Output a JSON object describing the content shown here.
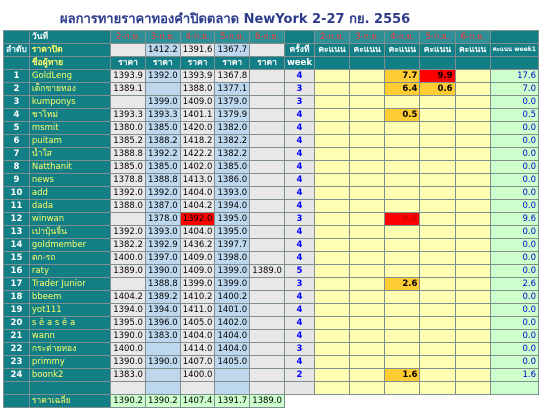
{
  "title": "ผลการทายราคาทองคำปิดตลาด NewYork 2-27 กย. 2556",
  "labels": {
    "day": "วันที่",
    "close_price": "ราคาปิด",
    "guesser": "ชื่อผู้ทาย",
    "price": "ราคา",
    "rank": "ลำดับ",
    "times": "ครั้งที่",
    "week": "week",
    "score": "คะแนน",
    "score_week": "คะแนน week1",
    "average": "ราคาเฉลี่ย"
  },
  "dates": [
    "2-ก.ย.",
    "3-ก.ย.",
    "4-ก.ย.",
    "5-ก.ย.",
    "6-ก.ย."
  ],
  "close_prices": [
    "",
    "1412.2",
    "1391.6",
    "1367.7",
    ""
  ],
  "rows": [
    {
      "n": "1",
      "name": "GoldLeng",
      "p": [
        "1393.9",
        "1392.0",
        "1393.9",
        "1367.8",
        ""
      ],
      "t": "4",
      "s": [
        "",
        "",
        "7.7",
        "9.9",
        ""
      ],
      "w": "17.6"
    },
    {
      "n": "2",
      "name": "เด็กขายทอง",
      "p": [
        "1389.1",
        "",
        "1388.0",
        "1377.1",
        ""
      ],
      "t": "3",
      "s": [
        "",
        "",
        "6.4",
        "0.6",
        ""
      ],
      "w": "7.0"
    },
    {
      "n": "3",
      "name": "kumponys",
      "p": [
        "",
        "1399.0",
        "1409.0",
        "1379.0",
        ""
      ],
      "t": "3",
      "s": [
        "",
        "",
        "",
        "",
        ""
      ],
      "w": "0.0"
    },
    {
      "n": "4",
      "name": "ชาไหม่",
      "p": [
        "1393.3",
        "1393.3",
        "1401.1",
        "1379.9",
        ""
      ],
      "t": "4",
      "s": [
        "",
        "",
        "0.5",
        "",
        ""
      ],
      "w": "0.5"
    },
    {
      "n": "5",
      "name": "msmit",
      "p": [
        "1380.0",
        "1385.0",
        "1420.0",
        "1382.0",
        ""
      ],
      "t": "4",
      "s": [
        "",
        "",
        "",
        "",
        ""
      ],
      "w": "0.0"
    },
    {
      "n": "6",
      "name": "puitam",
      "p": [
        "1385.2",
        "1388.2",
        "1418.2",
        "1382.2",
        ""
      ],
      "t": "4",
      "s": [
        "",
        "",
        "",
        "",
        ""
      ],
      "w": "0.0"
    },
    {
      "n": "7",
      "name": "น้ำใส",
      "p": [
        "1388.8",
        "1392.2",
        "1422.2",
        "1382.2",
        ""
      ],
      "t": "4",
      "s": [
        "",
        "",
        "",
        "",
        ""
      ],
      "w": "0.0"
    },
    {
      "n": "8",
      "name": "Natthanit",
      "p": [
        "1385.0",
        "1385.0",
        "1402.0",
        "1385.0",
        ""
      ],
      "t": "4",
      "s": [
        "",
        "",
        "",
        "",
        ""
      ],
      "w": "0.0"
    },
    {
      "n": "9",
      "name": "news",
      "p": [
        "1378.8",
        "1388.8",
        "1413.0",
        "1386.0",
        ""
      ],
      "t": "4",
      "s": [
        "",
        "",
        "",
        "",
        ""
      ],
      "w": "0.0"
    },
    {
      "n": "10",
      "name": "add",
      "p": [
        "1392.0",
        "1392.0",
        "1404.0",
        "1393.0",
        ""
      ],
      "t": "4",
      "s": [
        "",
        "",
        "",
        "",
        ""
      ],
      "w": "0.0"
    },
    {
      "n": "11",
      "name": "dada",
      "p": [
        "1388.0",
        "1387.0",
        "1404.2",
        "1394.0",
        ""
      ],
      "t": "4",
      "s": [
        "",
        "",
        "",
        "",
        ""
      ],
      "w": "0.0"
    },
    {
      "n": "12",
      "name": "winwan",
      "p": [
        "",
        "1378.0",
        "1392.0",
        "1395.0",
        ""
      ],
      "t": "3",
      "s": [
        "",
        "",
        "9.6",
        "",
        ""
      ],
      "w": "9.6"
    },
    {
      "n": "13",
      "name": "เปาบุ้นจิ้น",
      "p": [
        "1392.0",
        "1393.0",
        "1404.0",
        "1395.0",
        ""
      ],
      "t": "4",
      "s": [
        "",
        "",
        "",
        "",
        ""
      ],
      "w": "0.0"
    },
    {
      "n": "14",
      "name": "goldmember",
      "p": [
        "1382.2",
        "1392.9",
        "1436.2",
        "1397.7",
        ""
      ],
      "t": "4",
      "s": [
        "",
        "",
        "",
        "",
        ""
      ],
      "w": "0.0"
    },
    {
      "n": "15",
      "name": "ตก-รถ",
      "p": [
        "1400.0",
        "1397.0",
        "1409.0",
        "1398.0",
        ""
      ],
      "t": "4",
      "s": [
        "",
        "",
        "",
        "",
        ""
      ],
      "w": "0.0"
    },
    {
      "n": "16",
      "name": "raty",
      "p": [
        "1389.0",
        "1390.0",
        "1409.0",
        "1399.0",
        "1389.0"
      ],
      "t": "5",
      "s": [
        "",
        "",
        "",
        "",
        ""
      ],
      "w": "0.0"
    },
    {
      "n": "17",
      "name": "Trader Junior",
      "p": [
        "",
        "1388.8",
        "1399.0",
        "1399.0",
        ""
      ],
      "t": "3",
      "s": [
        "",
        "",
        "2.6",
        "",
        ""
      ],
      "w": "2.6"
    },
    {
      "n": "18",
      "name": "bbeem",
      "p": [
        "1404.2",
        "1389.2",
        "1410.2",
        "1400.2",
        ""
      ],
      "t": "4",
      "s": [
        "",
        "",
        "",
        "",
        ""
      ],
      "w": "0.0"
    },
    {
      "n": "19",
      "name": "yot111",
      "p": [
        "1394.0",
        "1394.0",
        "1411.0",
        "1401.0",
        ""
      ],
      "t": "4",
      "s": [
        "",
        "",
        "",
        "",
        ""
      ],
      "w": "0.0"
    },
    {
      "n": "20",
      "name": "s ê a s ê a",
      "p": [
        "1395.0",
        "1396.0",
        "1405.0",
        "1402.0",
        ""
      ],
      "t": "4",
      "s": [
        "",
        "",
        "",
        "",
        ""
      ],
      "w": "0.0"
    },
    {
      "n": "21",
      "name": "wann",
      "p": [
        "1390.0",
        "1383.0",
        "1404.0",
        "1404.0",
        ""
      ],
      "t": "4",
      "s": [
        "",
        "",
        "",
        "",
        ""
      ],
      "w": "0.0"
    },
    {
      "n": "22",
      "name": "กระต่ายทอง",
      "p": [
        "1400.0",
        "",
        "1414.0",
        "1404.0",
        ""
      ],
      "t": "3",
      "s": [
        "",
        "",
        "",
        "",
        ""
      ],
      "w": "0.0"
    },
    {
      "n": "23",
      "name": "primmy",
      "p": [
        "1390.0",
        "1390.0",
        "1407.0",
        "1405.0",
        ""
      ],
      "t": "4",
      "s": [
        "",
        "",
        "",
        "",
        ""
      ],
      "w": "0.0"
    },
    {
      "n": "24",
      "name": "boonk2",
      "p": [
        "1383.0",
        "",
        "1400.0",
        "",
        ""
      ],
      "t": "2",
      "s": [
        "",
        "",
        "1.6",
        "",
        ""
      ],
      "w": "1.6"
    }
  ],
  "averages": [
    "1390.2",
    "1390.2",
    "1407.4",
    "1391.7",
    "1389.0"
  ],
  "colors": {
    "teal_header": "#127f87",
    "name_text": "#ffff66",
    "score_bg": "#ffffb4",
    "highlight_orange": "#ffcc33",
    "highlight_red": "#ff0000",
    "week_total_bg": "#ccffcc",
    "price_col_gray": "#e8e8e8",
    "price_col_blue": "#bdd7ee"
  }
}
